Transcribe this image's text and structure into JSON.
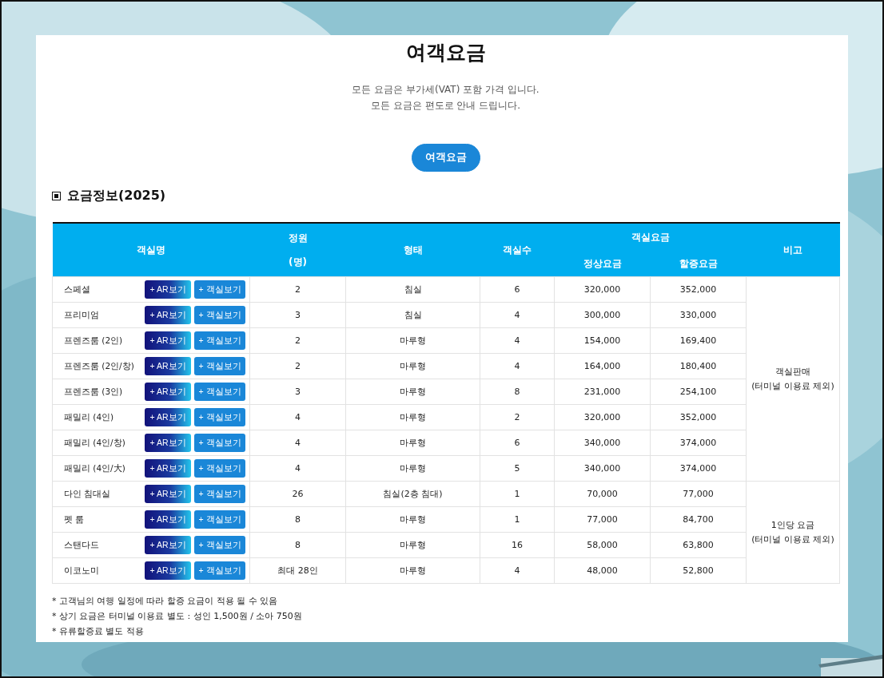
{
  "title": "여객요금",
  "subtitle": "모든 요금은 부가세(VAT) 포함 가격 입니다.\n모든 요금은 편도로 안내 드립니다.",
  "tabs": [
    {
      "label": "여객요금",
      "selected": true
    }
  ],
  "section_title": "요금정보(2025)",
  "table": {
    "columns": [
      {
        "label": "객실명",
        "rowspan": 2
      },
      {
        "label": "정원\n(명)",
        "rowspan": 2
      },
      {
        "label": "형태",
        "rowspan": 2
      },
      {
        "label": "객실수",
        "rowspan": 2
      },
      {
        "label": "객실요금",
        "colspan": 2
      },
      {
        "label": "비고",
        "rowspan": 2
      }
    ],
    "sub_columns": [
      "정상요금",
      "할증요금"
    ],
    "groups": [
      {
        "note": "객실판매\n(터미널 이용료 제외)",
        "rows": [
          {
            "name": "스페셜",
            "ar_button": "+ AR보기",
            "room_button": "+ 객실보기",
            "capacity": "2",
            "type": "침실",
            "rooms": "6",
            "regular": "320,000",
            "surcharge": "352,000"
          },
          {
            "name": "프리미엄",
            "ar_button": "+ AR보기",
            "room_button": "+ 객실보기",
            "capacity": "3",
            "type": "침실",
            "rooms": "4",
            "regular": "300,000",
            "surcharge": "330,000"
          },
          {
            "name": "프렌즈룸 (2인)",
            "ar_button": "+ AR보기",
            "room_button": "+ 객실보기",
            "capacity": "2",
            "type": "마루형",
            "rooms": "4",
            "regular": "154,000",
            "surcharge": "169,400"
          },
          {
            "name": "프렌즈룸 (2인/창)",
            "ar_button": "+ AR보기",
            "room_button": "+ 객실보기",
            "capacity": "2",
            "type": "마루형",
            "rooms": "4",
            "regular": "164,000",
            "surcharge": "180,400"
          },
          {
            "name": "프렌즈룸 (3인)",
            "ar_button": "+ AR보기",
            "room_button": "+ 객실보기",
            "capacity": "3",
            "type": "마루형",
            "rooms": "8",
            "regular": "231,000",
            "surcharge": "254,100"
          },
          {
            "name": "패밀리 (4인)",
            "ar_button": "+ AR보기",
            "room_button": "+ 객실보기",
            "capacity": "4",
            "type": "마루형",
            "rooms": "2",
            "regular": "320,000",
            "surcharge": "352,000"
          },
          {
            "name": "패밀리 (4인/창)",
            "ar_button": "+ AR보기",
            "room_button": "+ 객실보기",
            "capacity": "4",
            "type": "마루형",
            "rooms": "6",
            "regular": "340,000",
            "surcharge": "374,000"
          },
          {
            "name": "패밀리 (4인/大)",
            "ar_button": "+ AR보기",
            "room_button": "+ 객실보기",
            "capacity": "4",
            "type": "마루형",
            "rooms": "5",
            "regular": "340,000",
            "surcharge": "374,000"
          }
        ]
      },
      {
        "note": "1인당 요금\n(터미널 이용료 제외)",
        "rows": [
          {
            "name": "다인 침대실",
            "ar_button": "+ AR보기",
            "room_button": "+ 객실보기",
            "capacity": "26",
            "type": "침실(2층 침대)",
            "rooms": "1",
            "regular": "70,000",
            "surcharge": "77,000"
          },
          {
            "name": "펫 룸",
            "ar_button": "+ AR보기",
            "room_button": "+ 객실보기",
            "capacity": "8",
            "type": "마루형",
            "rooms": "1",
            "regular": "77,000",
            "surcharge": "84,700"
          },
          {
            "name": "스탠다드",
            "ar_button": "+ AR보기",
            "room_button": "+ 객실보기",
            "capacity": "8",
            "type": "마루형",
            "rooms": "16",
            "regular": "58,000",
            "surcharge": "63,800"
          },
          {
            "name": "이코노미",
            "ar_button": "+ AR보기",
            "room_button": "+ 객실보기",
            "capacity": "최대 28인",
            "type": "마루형",
            "rooms": "4",
            "regular": "48,000",
            "surcharge": "52,800"
          }
        ]
      }
    ]
  },
  "footnotes": [
    "* 고객님의 여행 일정에 따라 할증 요금이 적용 될 수 있음",
    "* 상기 요금은 터미널 이용료 별도 : 성인 1,500원 / 소아 750원",
    "* 유류할증료 별도 적용"
  ]
}
